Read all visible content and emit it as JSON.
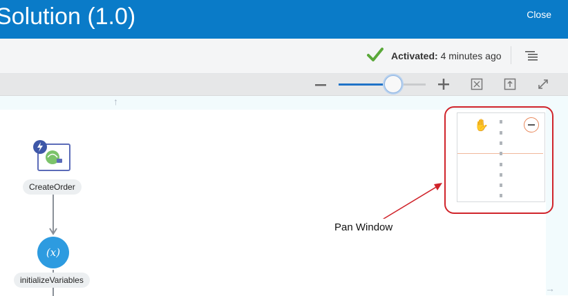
{
  "header": {
    "title": "Solution (1.0)",
    "close_label": "Close",
    "bg_color": "#0a7bc8"
  },
  "status_bar": {
    "status_label": "Activated:",
    "status_time": "4 minutes ago",
    "check_color": "#5aa839"
  },
  "toolbar": {
    "zoom_level_fraction": 0.63,
    "icons": [
      "zoom-out-icon",
      "zoom-in-icon",
      "fit-to-screen-icon",
      "reset-icon",
      "fullscreen-icon"
    ]
  },
  "canvas": {
    "nodes": [
      {
        "label": "CreateOrder",
        "icon": "rest-trigger-icon"
      },
      {
        "label": "initializeVariables",
        "icon": "variables-icon",
        "glyph": "(x)"
      }
    ],
    "annotation": "Pan Window",
    "annotation_color": "#d0232a"
  }
}
